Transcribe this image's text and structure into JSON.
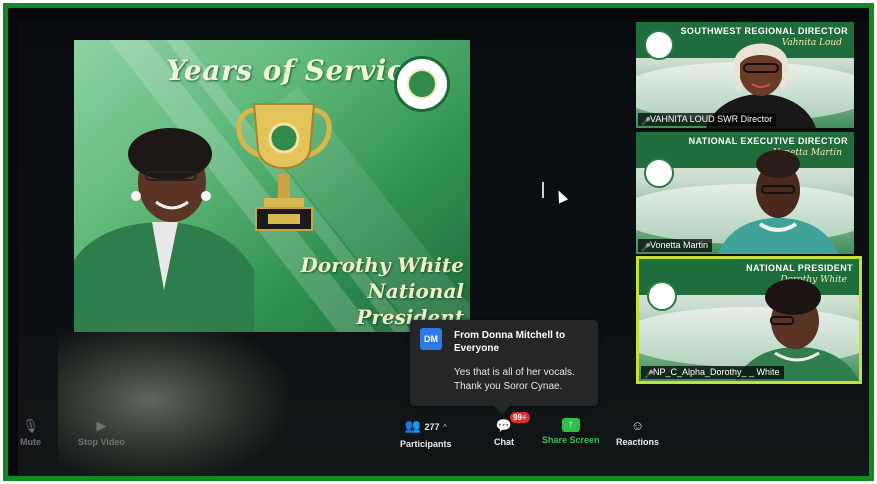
{
  "slide": {
    "title": "Years of Service",
    "name_line1": "Dorothy White",
    "name_line2": "National President"
  },
  "participants_tiles": [
    {
      "banner": "SOUTHWEST REGIONAL DIRECTOR",
      "subname": "Vahnita Loud",
      "label": "VAHNITA LOUD SWR Director",
      "active": false
    },
    {
      "banner": "NATIONAL EXECUTIVE DIRECTOR",
      "subname": "Vonetta Martin",
      "label": "Vonetta Martin",
      "active": false
    },
    {
      "banner": "NATIONAL PRESIDENT",
      "subname": "Dorothy White",
      "label": "NP_C_Alpha_Dorothy_ _ White",
      "active": true
    }
  ],
  "chat_popup": {
    "initials": "DM",
    "title": "From Donna Mitchell to Everyone",
    "message": "Yes that is all of her vocals. Thank you Soror Cynae."
  },
  "toolbar": {
    "mute": "Mute",
    "stop_video": "Stop Video",
    "participants_count": "277",
    "participants": "Participants",
    "chat_badge": "99+",
    "chat": "Chat",
    "share_screen": "Share Screen",
    "reactions": "Reactions"
  },
  "colors": {
    "frame_border": "#0f8a1e",
    "active_speaker": "#c6e03a",
    "share_green": "#2fbf4a",
    "badge_red": "#e02d2d"
  },
  "icons": {
    "mute": "microphone-icon",
    "stop_video": "video-camera-icon",
    "participants": "people-icon",
    "chat": "chat-bubble-icon",
    "share": "share-screen-icon",
    "reactions": "smiley-plus-icon"
  }
}
